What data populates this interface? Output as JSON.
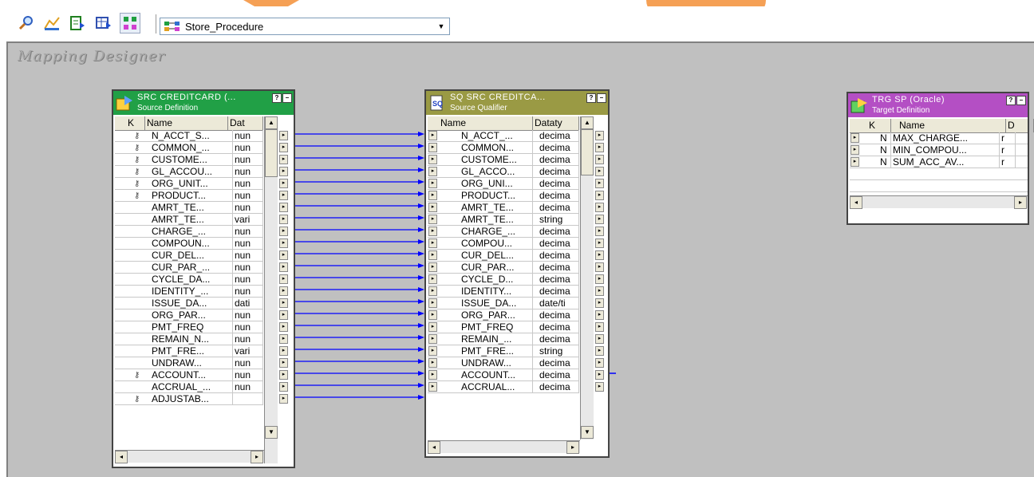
{
  "toolbar": {
    "icons": [
      "magnifier-icon",
      "source-analyzer-icon",
      "target-designer-icon",
      "table-icon",
      "mapping-designer-icon"
    ],
    "mapping_select": {
      "value": "Store_Procedure"
    }
  },
  "workspace": {
    "title": "Mapping Designer"
  },
  "source_definition": {
    "name": "SRC CREDITCARD (...",
    "type": "Source Definition",
    "columns": [
      "K",
      "Name",
      "Dat"
    ],
    "rows": [
      {
        "key": true,
        "name": "N_ACCT_S...",
        "dtype": "nun"
      },
      {
        "key": true,
        "name": "COMMON_...",
        "dtype": "nun"
      },
      {
        "key": true,
        "name": "CUSTOME...",
        "dtype": "nun"
      },
      {
        "key": true,
        "name": "GL_ACCOU...",
        "dtype": "nun"
      },
      {
        "key": true,
        "name": "ORG_UNIT...",
        "dtype": "nun"
      },
      {
        "key": true,
        "name": "PRODUCT...",
        "dtype": "nun"
      },
      {
        "key": false,
        "name": "AMRT_TE...",
        "dtype": "nun"
      },
      {
        "key": false,
        "name": "AMRT_TE...",
        "dtype": "vari"
      },
      {
        "key": false,
        "name": "CHARGE_...",
        "dtype": "nun"
      },
      {
        "key": false,
        "name": "COMPOUN...",
        "dtype": "nun"
      },
      {
        "key": false,
        "name": "CUR_DEL...",
        "dtype": "nun"
      },
      {
        "key": false,
        "name": "CUR_PAR_...",
        "dtype": "nun"
      },
      {
        "key": false,
        "name": "CYCLE_DA...",
        "dtype": "nun"
      },
      {
        "key": false,
        "name": "IDENTITY_...",
        "dtype": "nun"
      },
      {
        "key": false,
        "name": "ISSUE_DA...",
        "dtype": "dati"
      },
      {
        "key": false,
        "name": "ORG_PAR...",
        "dtype": "nun"
      },
      {
        "key": false,
        "name": "PMT_FREQ",
        "dtype": "nun"
      },
      {
        "key": false,
        "name": "REMAIN_N...",
        "dtype": "nun"
      },
      {
        "key": false,
        "name": "PMT_FRE...",
        "dtype": "vari"
      },
      {
        "key": false,
        "name": "UNDRAW...",
        "dtype": "nun"
      },
      {
        "key": true,
        "name": "ACCOUNT...",
        "dtype": "nun"
      },
      {
        "key": false,
        "name": "ACCRUAL_...",
        "dtype": "nun"
      },
      {
        "key": true,
        "name": "ADJUSTAB...",
        "dtype": ""
      }
    ]
  },
  "source_qualifier": {
    "name": "SQ SRC CREDITCA...",
    "type": "Source Qualifier",
    "columns": [
      "Name",
      "Dataty"
    ],
    "rows": [
      {
        "name": "N_ACCT_...",
        "dtype": "decima"
      },
      {
        "name": "COMMON...",
        "dtype": "decima"
      },
      {
        "name": "CUSTOME...",
        "dtype": "decima"
      },
      {
        "name": "GL_ACCO...",
        "dtype": "decima"
      },
      {
        "name": "ORG_UNI...",
        "dtype": "decima"
      },
      {
        "name": "PRODUCT...",
        "dtype": "decima"
      },
      {
        "name": "AMRT_TE...",
        "dtype": "decima"
      },
      {
        "name": "AMRT_TE...",
        "dtype": "string"
      },
      {
        "name": "CHARGE_...",
        "dtype": "decima"
      },
      {
        "name": "COMPOU...",
        "dtype": "decima"
      },
      {
        "name": "CUR_DEL...",
        "dtype": "decima"
      },
      {
        "name": "CUR_PAR...",
        "dtype": "decima"
      },
      {
        "name": "CYCLE_D...",
        "dtype": "decima"
      },
      {
        "name": "IDENTITY...",
        "dtype": "decima"
      },
      {
        "name": "ISSUE_DA...",
        "dtype": "date/ti"
      },
      {
        "name": "ORG_PAR...",
        "dtype": "decima"
      },
      {
        "name": "PMT_FREQ",
        "dtype": "decima"
      },
      {
        "name": "REMAIN_...",
        "dtype": "decima"
      },
      {
        "name": "PMT_FRE...",
        "dtype": "string"
      },
      {
        "name": "UNDRAW...",
        "dtype": "decima"
      },
      {
        "name": "ACCOUNT...",
        "dtype": "decima"
      },
      {
        "name": "ACCRUAL...",
        "dtype": "decima"
      }
    ]
  },
  "target_definition": {
    "name": "TRG SP (Oracle)",
    "type": "Target Definition",
    "columns": [
      "K",
      "Name",
      "D"
    ],
    "rows": [
      {
        "key": "N",
        "name": "MAX_CHARGE...",
        "dtype": "r"
      },
      {
        "key": "N",
        "name": "MIN_COMPOU...",
        "dtype": "r"
      },
      {
        "key": "N",
        "name": "SUM_ACC_AV...",
        "dtype": "r"
      }
    ]
  },
  "colors": {
    "workspace": "#c0c0c0",
    "source_header": "#21a046",
    "qualifier_header": "#9a9a44",
    "target_header": "#b44fc4",
    "link": "#0000ff"
  }
}
